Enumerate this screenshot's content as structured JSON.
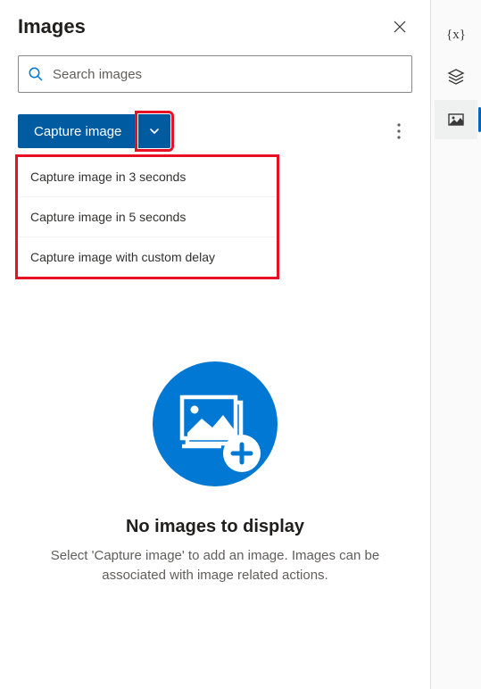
{
  "panel": {
    "title": "Images"
  },
  "search": {
    "placeholder": "Search images"
  },
  "toolbar": {
    "capture_label": "Capture image"
  },
  "dropdown": {
    "items": [
      {
        "label": "Capture image in 3 seconds"
      },
      {
        "label": "Capture image in 5 seconds"
      },
      {
        "label": "Capture image with custom delay"
      }
    ]
  },
  "empty": {
    "title": "No images to display",
    "description": "Select 'Capture image' to add an image. Images can be associated with image related actions."
  },
  "rail": {
    "items": [
      {
        "name": "variables",
        "selected": false
      },
      {
        "name": "layers",
        "selected": false
      },
      {
        "name": "images",
        "selected": true
      }
    ]
  },
  "colors": {
    "primary": "#005ba1",
    "highlight": "#e81123",
    "accent": "#0078d4"
  }
}
